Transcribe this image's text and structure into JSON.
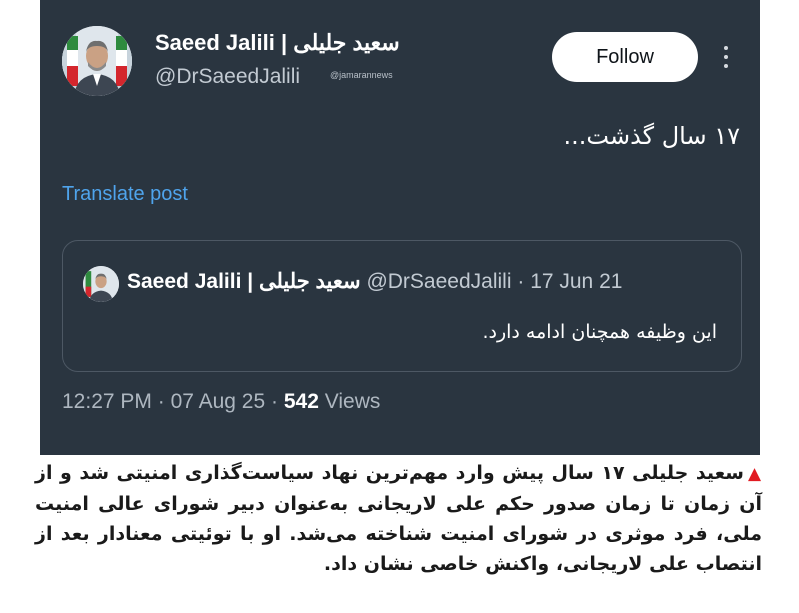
{
  "tweet": {
    "author_name": "Saeed Jalili | سعید جلیلی",
    "handle": "@DrSaeedJalili",
    "watermark": "@jamarannews",
    "follow_label": "Follow",
    "text": "۱۷ سال گذشت...",
    "translate_label": "Translate post",
    "quoted": {
      "author_name": "Saeed Jalili | سعید جلیلی",
      "handle": "@DrSaeedJalili",
      "date": "17 Jun 21",
      "text": "این وظیفه همچنان ادامه دارد."
    },
    "time": "12:27 PM",
    "date": "07 Aug 25",
    "views_count": "542",
    "views_label": "Views"
  },
  "caption": {
    "marker": "▲",
    "text": "سعید جلیلی ۱۷ سال پیش وارد مهم‌ترین نهاد سیاست‌گذاری امنیتی شد و از آن زمان تا زمان صدور حکم علی لاریجانی به‌عنوان دبیر شورای عالی امنیت ملی، فرد موثری در شورای امنیت شناخته می‌شد. او با توئیتی معنادار بعد از انتصاب علی لاریجانی، واکنش خاصی نشان داد."
  },
  "colors": {
    "card_background": "#2a3540",
    "link": "#4fa4ec",
    "marker": "#e11b22"
  }
}
